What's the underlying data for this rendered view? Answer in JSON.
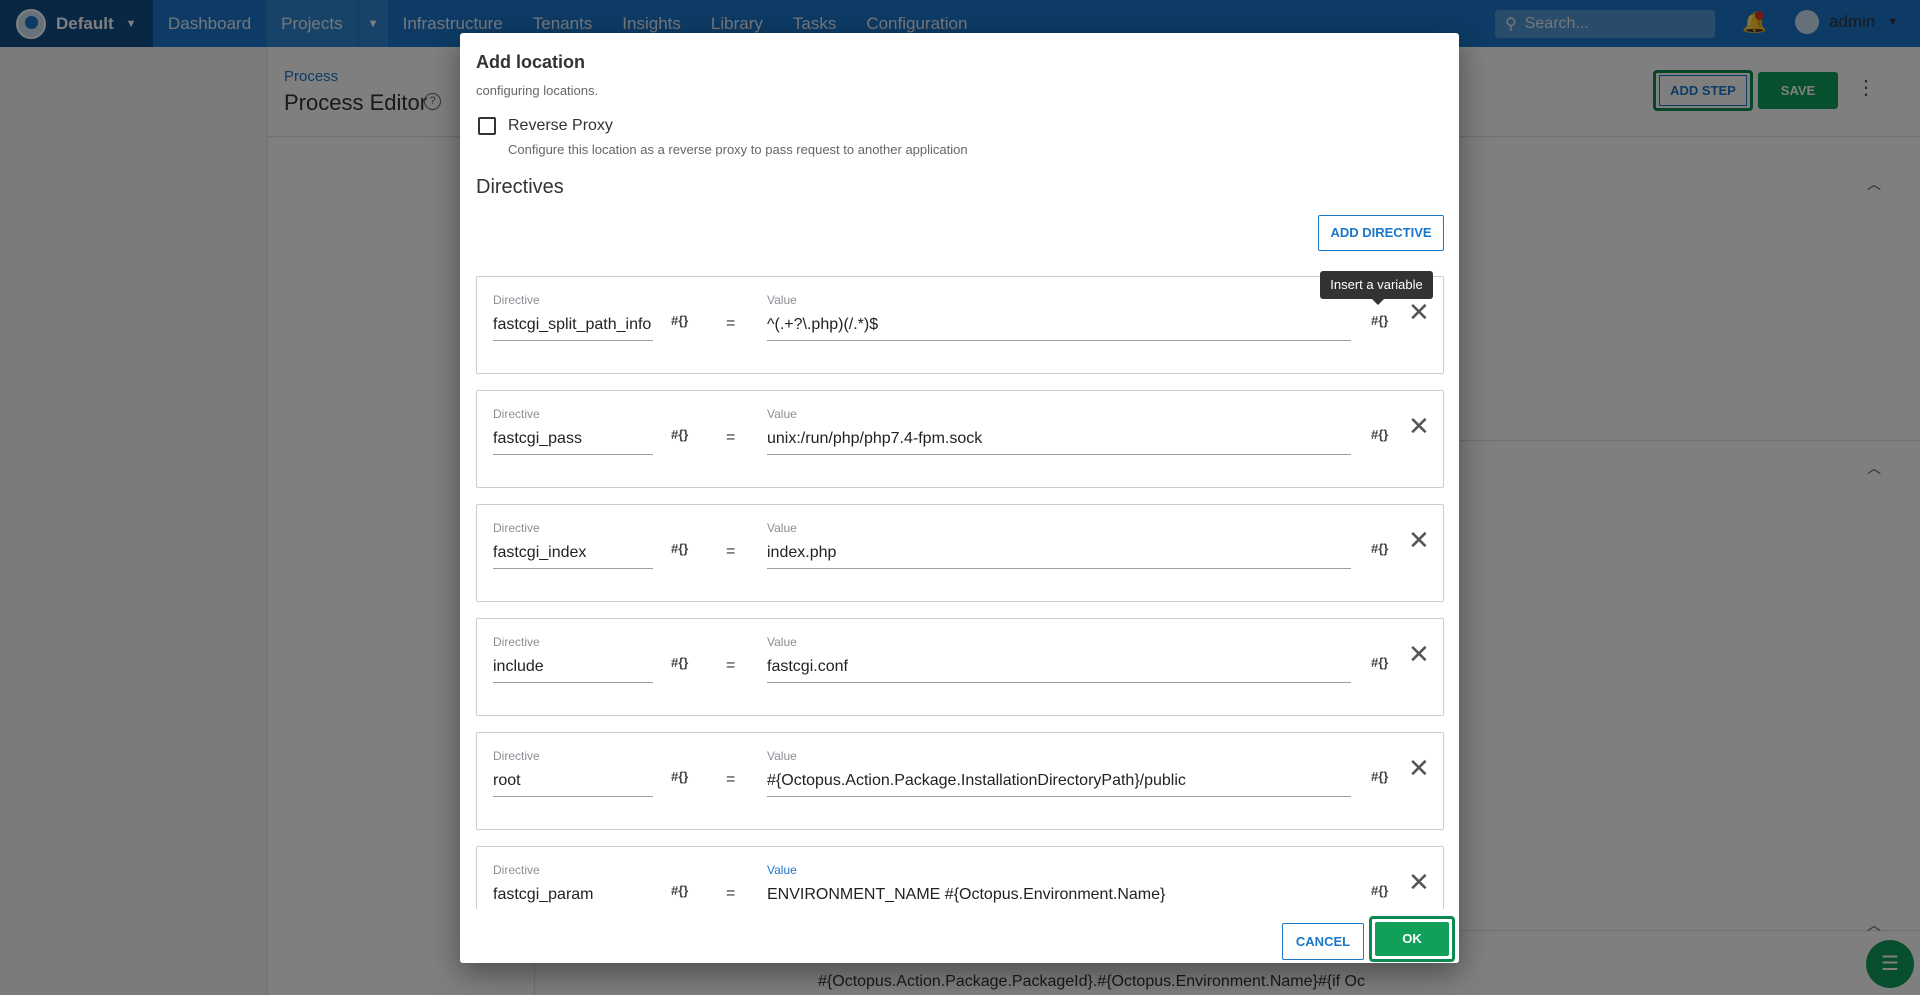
{
  "nav": {
    "space": "Default",
    "items": [
      "Dashboard",
      "Projects",
      "Infrastructure",
      "Tenants",
      "Insights",
      "Library",
      "Tasks",
      "Configuration"
    ],
    "search_placeholder": "Search...",
    "user": "admin"
  },
  "page": {
    "breadcrumb": "Process",
    "title": "Process Editor",
    "add_step": "ADD STEP",
    "save": "SAVE",
    "bottom_text": "#{Octopus.Action.Package.PackageId}.#{Octopus.Environment.Name}#{if Oc"
  },
  "dialog": {
    "title": "Add location",
    "cut_text": "configuring locations.",
    "reverse_proxy_label": "Reverse Proxy",
    "reverse_proxy_help": "Configure this location as a reverse proxy to pass request to another application",
    "section_title": "Directives",
    "add_directive": "ADD DIRECTIVE",
    "directive_label": "Directive",
    "value_label": "Value",
    "var_icon": "#{}",
    "equals": "=",
    "tooltip": "Insert a variable",
    "directives": [
      {
        "directive": "fastcgi_split_path_info",
        "value": "^(.+?\\.php)(/.*)$"
      },
      {
        "directive": "fastcgi_pass",
        "value": "unix:/run/php/php7.4-fpm.sock"
      },
      {
        "directive": "fastcgi_index",
        "value": "index.php"
      },
      {
        "directive": "include",
        "value": "fastcgi.conf"
      },
      {
        "directive": "root",
        "value": "#{Octopus.Action.Package.InstallationDirectoryPath}/public"
      },
      {
        "directive": "fastcgi_param",
        "value": "ENVIRONMENT_NAME #{Octopus.Environment.Name}"
      }
    ],
    "cancel": "CANCEL",
    "ok": "OK"
  },
  "colors": {
    "nav": "#1a77ca",
    "primary": "#1a77ca",
    "success": "#11a05a",
    "highlight": "#0d8a50"
  }
}
